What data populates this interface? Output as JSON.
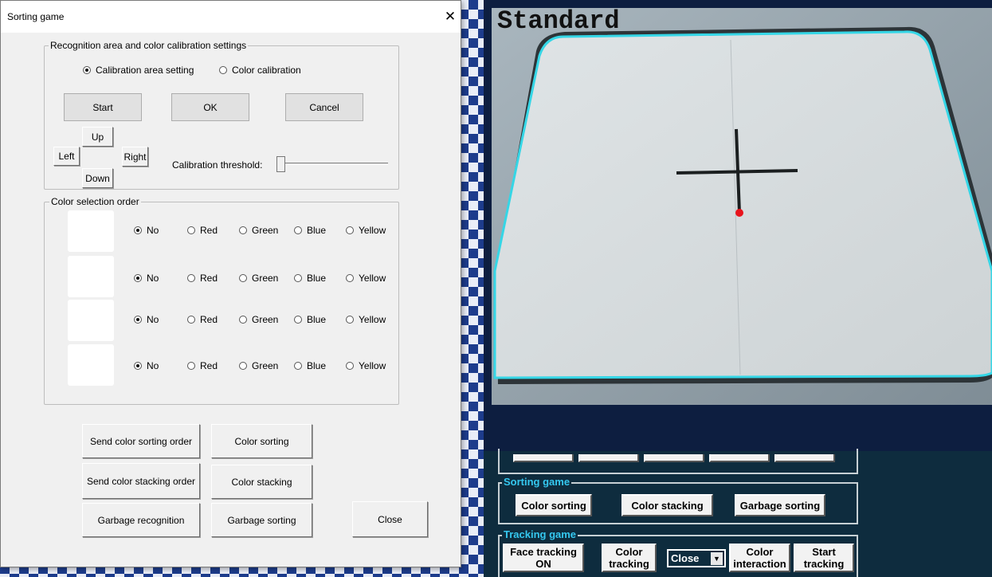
{
  "dialog": {
    "title": "Sorting game",
    "close_glyph": "✕",
    "calibration_group": {
      "legend": "Recognition area and color calibration settings",
      "radio_area": "Calibration area setting",
      "radio_color": "Color calibration",
      "selected": "area",
      "start": "Start",
      "ok": "OK",
      "cancel": "Cancel",
      "up": "Up",
      "down": "Down",
      "left": "Left",
      "right": "Right",
      "threshold_label": "Calibration threshold:",
      "threshold_value": 0
    },
    "color_order_group": {
      "legend": "Color selection order",
      "options": [
        "No",
        "Red",
        "Green",
        "Blue",
        "Yellow"
      ],
      "rows": [
        {
          "selected": "No"
        },
        {
          "selected": "No"
        },
        {
          "selected": "No"
        },
        {
          "selected": "No"
        }
      ]
    },
    "buttons": {
      "send_sorting_order": "Send color sorting order",
      "color_sorting": "Color sorting",
      "send_stacking_order": "Send color stacking order",
      "color_stacking": "Color stacking",
      "garbage_recognition": "Garbage recognition",
      "garbage_sorting": "Garbage sorting",
      "close": "Close"
    }
  },
  "camera": {
    "overlay_label": "Standard"
  },
  "control_panel": {
    "sorting_game": {
      "legend": "Sorting game",
      "color_sorting": "Color sorting",
      "color_stacking": "Color stacking",
      "garbage_sorting": "Garbage sorting"
    },
    "tracking_game": {
      "legend": "Tracking game",
      "face_tracking": "Face tracking ON",
      "color_tracking": "Color tracking",
      "select_value": "Close",
      "color_interaction": "Color interaction",
      "start_tracking": "Start tracking"
    }
  },
  "colors": {
    "outline_cyan": "#35d6e6",
    "marker_red": "#e8141c",
    "legend_cyan": "#35c8f0"
  }
}
